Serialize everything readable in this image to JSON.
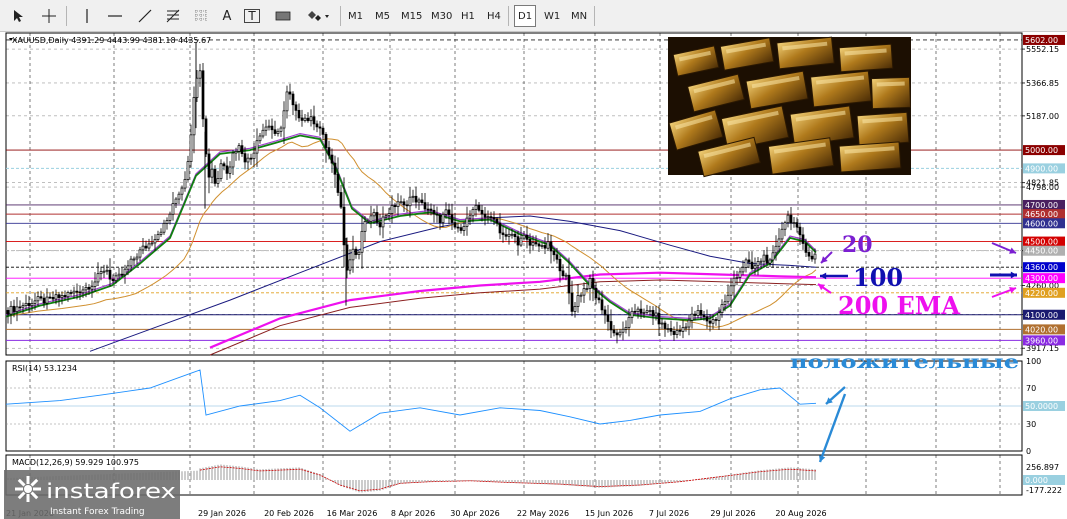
{
  "toolbar": {
    "icons": [
      "cursor-icon",
      "crosshair-icon",
      "vertical-line-icon",
      "horizontal-line-icon",
      "trendline-icon",
      "fibonacci-icon",
      "grid-channel-icon",
      "text-tool-icon",
      "text-label-icon",
      "rectangle-icon",
      "shapes-dropdown-icon"
    ],
    "text_tool_glyph": "A",
    "label_tool_glyph": "T",
    "timeframes": [
      "M1",
      "M5",
      "M15",
      "M30",
      "H1",
      "H4",
      "D1",
      "W1",
      "MN"
    ],
    "active_timeframe": "D1"
  },
  "chart_header": "XAUUSD,Daily  4391.29 4443.99 4381.18 4435.67",
  "price_axis": {
    "ticks": [
      {
        "label": "5552.15",
        "price": 5552.15
      },
      {
        "label": "5366.85",
        "price": 5366.85
      },
      {
        "label": "5187.00",
        "price": 5187.0
      },
      {
        "label": "4821.85",
        "price": 4821.85
      },
      {
        "label": "4798.00",
        "price": 4798.0
      },
      {
        "label": "4450.00",
        "price": 4450.0
      },
      {
        "label": "4260.00",
        "price": 4260.0
      },
      {
        "label": "4102.00",
        "price": 4102.0
      },
      {
        "label": "3917.15",
        "price": 3917.15
      }
    ],
    "levels": [
      {
        "label": "5602.00",
        "price": 5602,
        "bg": "#8b0000",
        "fg": "#ffffff",
        "line": "#222222",
        "dash": "4,3"
      },
      {
        "label": "5000.00",
        "price": 5000,
        "bg": "#8b0000",
        "fg": "#ffffff",
        "line": "#8b0000",
        "dash": ""
      },
      {
        "label": "4900.00",
        "price": 4900,
        "bg": "#9ad0e0",
        "fg": "#ffffff",
        "line": "#9ad0e0",
        "dash": "3,2"
      },
      {
        "label": "4700.00",
        "price": 4700,
        "bg": "#4a2060",
        "fg": "#ffffff",
        "line": "#4a2060",
        "dash": ""
      },
      {
        "label": "4650.00",
        "price": 4650,
        "bg": "#b03030",
        "fg": "#ffffff",
        "line": "#b03030",
        "dash": ""
      },
      {
        "label": "4600.00",
        "price": 4600,
        "bg": "#303090",
        "fg": "#ffffff",
        "line": "#303090",
        "dash": ""
      },
      {
        "label": "4500.00",
        "price": 4500,
        "bg": "#d40000",
        "fg": "#ffffff",
        "line": "#d40000",
        "dash": ""
      },
      {
        "label": "4450.00",
        "price": 4450,
        "bg": "#b0b0b0",
        "fg": "#ffffff",
        "line": "#b0b0b0",
        "dash": "3,2"
      },
      {
        "label": "4360.00",
        "price": 4360,
        "bg": "#0000cc",
        "fg": "#ffffff",
        "line": "#000000",
        "dash": "3,2"
      },
      {
        "label": "4300.00",
        "price": 4300,
        "bg": "#ff00ff",
        "fg": "#ffffff",
        "line": "#ff00ff",
        "dash": ""
      },
      {
        "label": "4220.00",
        "price": 4220,
        "bg": "#e0a020",
        "fg": "#ffffff",
        "line": "#e0a020",
        "dash": "3,2"
      },
      {
        "label": "4100.00",
        "price": 4100,
        "bg": "#1a1a70",
        "fg": "#ffffff",
        "line": "#1a1a70",
        "dash": ""
      },
      {
        "label": "4020.00",
        "price": 4020,
        "bg": "#b07030",
        "fg": "#ffffff",
        "line": "#b07030",
        "dash": ""
      },
      {
        "label": "3960.00",
        "price": 3960,
        "bg": "#8a2be2",
        "fg": "#ffffff",
        "line": "#8a2be2",
        "dash": ""
      }
    ]
  },
  "time_axis": [
    "29 Jan 2026",
    "20 Feb 2026",
    "16 Mar 2026",
    "8 Apr 2026",
    "30 Apr 2026",
    "22 May 2026",
    "15 Jun 2026",
    "7 Jul 2026",
    "29 Jul 2026",
    "20 Aug 2026"
  ],
  "rsi": {
    "label": "RSI(14) 53.1234",
    "ticks": [
      "100",
      "70",
      "30",
      "0"
    ],
    "current": "50.0000",
    "levels": [
      70,
      30
    ]
  },
  "macd": {
    "label": "MACD(12,26,9) 59.929 100.975",
    "ticks": [
      "256.897",
      "0.000",
      "-177.222"
    ]
  },
  "annotations": {
    "ma20": "20",
    "ma100": "100",
    "ema200": "200 EMA",
    "positive": "положительные",
    "colors": {
      "ma20": "#7b1fd1",
      "ma100": "#1010b0",
      "ema200": "#ee10ee",
      "positive": "#2a8ad6"
    }
  },
  "watermark": {
    "brand": "instaforex",
    "tagline": "Instant Forex Trading"
  },
  "chart_data": {
    "type": "candlestick",
    "symbol": "XAUUSD",
    "timeframe": "Daily",
    "x_dates": [
      "29 Jan 2026",
      "20 Feb 2026",
      "16 Mar 2026",
      "8 Apr 2026",
      "30 Apr 2026",
      "22 May 2026",
      "15 Jun 2026",
      "7 Jul 2026",
      "29 Jul 2026",
      "20 Aug 2026"
    ],
    "last_bar": {
      "open": 4391.29,
      "high": 4443.99,
      "low": 4381.18,
      "close": 4435.67
    },
    "ylim": [
      3880,
      5640
    ],
    "close_path": [
      [
        6,
        4120
      ],
      [
        14,
        4135
      ],
      [
        22,
        4150
      ],
      [
        30,
        4165
      ],
      [
        38,
        4180
      ],
      [
        46,
        4175
      ],
      [
        54,
        4190
      ],
      [
        62,
        4200
      ],
      [
        70,
        4215
      ],
      [
        78,
        4230
      ],
      [
        86,
        4250
      ],
      [
        94,
        4275
      ],
      [
        100,
        4320
      ],
      [
        106,
        4360
      ],
      [
        112,
        4280
      ],
      [
        118,
        4300
      ],
      [
        124,
        4330
      ],
      [
        130,
        4380
      ],
      [
        136,
        4420
      ],
      [
        142,
        4460
      ],
      [
        148,
        4480
      ],
      [
        154,
        4520
      ],
      [
        160,
        4560
      ],
      [
        166,
        4600
      ],
      [
        172,
        4680
      ],
      [
        178,
        4760
      ],
      [
        184,
        4820
      ],
      [
        188,
        4950
      ],
      [
        192,
        5150
      ],
      [
        196,
        5400
      ],
      [
        200,
        5450
      ],
      [
        204,
        5100
      ],
      [
        208,
        4850
      ],
      [
        212,
        4900
      ],
      [
        216,
        4800
      ],
      [
        222,
        4950
      ],
      [
        228,
        4880
      ],
      [
        234,
        5000
      ],
      [
        240,
        5020
      ],
      [
        246,
        4940
      ],
      [
        252,
        4960
      ],
      [
        258,
        5080
      ],
      [
        264,
        5120
      ],
      [
        270,
        5140
      ],
      [
        276,
        5060
      ],
      [
        282,
        5150
      ],
      [
        288,
        5340
      ],
      [
        292,
        5250
      ],
      [
        296,
        5200
      ],
      [
        302,
        5180
      ],
      [
        308,
        5170
      ],
      [
        314,
        5160
      ],
      [
        320,
        5120
      ],
      [
        326,
        5020
      ],
      [
        332,
        4920
      ],
      [
        338,
        4780
      ],
      [
        342,
        4650
      ],
      [
        346,
        4350
      ],
      [
        350,
        4400
      ],
      [
        354,
        4480
      ],
      [
        358,
        4380
      ],
      [
        362,
        4560
      ],
      [
        368,
        4620
      ],
      [
        374,
        4640
      ],
      [
        380,
        4600
      ],
      [
        386,
        4650
      ],
      [
        392,
        4680
      ],
      [
        398,
        4720
      ],
      [
        404,
        4690
      ],
      [
        410,
        4740
      ],
      [
        416,
        4730
      ],
      [
        422,
        4700
      ],
      [
        428,
        4680
      ],
      [
        434,
        4640
      ],
      [
        440,
        4620
      ],
      [
        446,
        4660
      ],
      [
        452,
        4600
      ],
      [
        458,
        4560
      ],
      [
        464,
        4600
      ],
      [
        470,
        4640
      ],
      [
        476,
        4680
      ],
      [
        482,
        4660
      ],
      [
        488,
        4620
      ],
      [
        494,
        4640
      ],
      [
        500,
        4560
      ],
      [
        506,
        4520
      ],
      [
        512,
        4540
      ],
      [
        518,
        4500
      ],
      [
        524,
        4520
      ],
      [
        530,
        4480
      ],
      [
        536,
        4500
      ],
      [
        542,
        4460
      ],
      [
        548,
        4480
      ],
      [
        554,
        4420
      ],
      [
        560,
        4360
      ],
      [
        566,
        4300
      ],
      [
        572,
        4120
      ],
      [
        578,
        4200
      ],
      [
        584,
        4240
      ],
      [
        590,
        4280
      ],
      [
        596,
        4200
      ],
      [
        602,
        4140
      ],
      [
        608,
        4060
      ],
      [
        614,
        4000
      ],
      [
        620,
        3990
      ],
      [
        626,
        4040
      ],
      [
        632,
        4100
      ],
      [
        638,
        4140
      ],
      [
        644,
        4100
      ],
      [
        650,
        4120
      ],
      [
        656,
        4090
      ],
      [
        662,
        4040
      ],
      [
        668,
        4020
      ],
      [
        674,
        4000
      ],
      [
        680,
        4010
      ],
      [
        686,
        4050
      ],
      [
        692,
        4090
      ],
      [
        698,
        4110
      ],
      [
        704,
        4080
      ],
      [
        710,
        4060
      ],
      [
        716,
        4080
      ],
      [
        722,
        4150
      ],
      [
        728,
        4200
      ],
      [
        734,
        4300
      ],
      [
        740,
        4340
      ],
      [
        746,
        4390
      ],
      [
        752,
        4350
      ],
      [
        758,
        4380
      ],
      [
        764,
        4420
      ],
      [
        770,
        4380
      ],
      [
        776,
        4460
      ],
      [
        782,
        4580
      ],
      [
        788,
        4640
      ],
      [
        794,
        4600
      ],
      [
        800,
        4520
      ],
      [
        806,
        4460
      ],
      [
        812,
        4400
      ],
      [
        816,
        4435
      ]
    ],
    "ma20_path": [
      [
        6,
        4090
      ],
      [
        40,
        4150
      ],
      [
        80,
        4200
      ],
      [
        112,
        4260
      ],
      [
        140,
        4380
      ],
      [
        170,
        4520
      ],
      [
        196,
        4860
      ],
      [
        220,
        4980
      ],
      [
        250,
        5000
      ],
      [
        276,
        5040
      ],
      [
        300,
        5080
      ],
      [
        320,
        5060
      ],
      [
        336,
        4900
      ],
      [
        352,
        4680
      ],
      [
        370,
        4600
      ],
      [
        400,
        4640
      ],
      [
        430,
        4660
      ],
      [
        460,
        4610
      ],
      [
        490,
        4620
      ],
      [
        520,
        4540
      ],
      [
        550,
        4480
      ],
      [
        570,
        4380
      ],
      [
        590,
        4260
      ],
      [
        610,
        4170
      ],
      [
        630,
        4100
      ],
      [
        660,
        4080
      ],
      [
        690,
        4070
      ],
      [
        710,
        4080
      ],
      [
        730,
        4150
      ],
      [
        750,
        4320
      ],
      [
        770,
        4380
      ],
      [
        790,
        4520
      ],
      [
        805,
        4500
      ],
      [
        816,
        4440
      ]
    ],
    "ma100_path": [
      [
        90,
        3900
      ],
      [
        160,
        4040
      ],
      [
        230,
        4180
      ],
      [
        300,
        4330
      ],
      [
        380,
        4500
      ],
      [
        440,
        4580
      ],
      [
        490,
        4630
      ],
      [
        530,
        4640
      ],
      [
        570,
        4610
      ],
      [
        620,
        4560
      ],
      [
        670,
        4480
      ],
      [
        710,
        4420
      ],
      [
        750,
        4380
      ],
      [
        790,
        4370
      ],
      [
        816,
        4360
      ]
    ],
    "ema200_path": [
      [
        210,
        3920
      ],
      [
        280,
        4080
      ],
      [
        350,
        4180
      ],
      [
        420,
        4230
      ],
      [
        480,
        4260
      ],
      [
        540,
        4280
      ],
      [
        600,
        4320
      ],
      [
        660,
        4330
      ],
      [
        720,
        4320
      ],
      [
        780,
        4310
      ],
      [
        816,
        4305
      ]
    ],
    "rsi_path": [
      [
        6,
        52
      ],
      [
        60,
        56
      ],
      [
        100,
        62
      ],
      [
        150,
        70
      ],
      [
        190,
        86
      ],
      [
        200,
        90
      ],
      [
        206,
        40
      ],
      [
        240,
        50
      ],
      [
        280,
        56
      ],
      [
        300,
        62
      ],
      [
        320,
        48
      ],
      [
        350,
        22
      ],
      [
        380,
        42
      ],
      [
        420,
        48
      ],
      [
        460,
        40
      ],
      [
        500,
        48
      ],
      [
        540,
        45
      ],
      [
        570,
        38
      ],
      [
        600,
        30
      ],
      [
        630,
        34
      ],
      [
        660,
        40
      ],
      [
        700,
        44
      ],
      [
        730,
        58
      ],
      [
        760,
        68
      ],
      [
        780,
        70
      ],
      [
        800,
        52
      ],
      [
        816,
        53
      ]
    ],
    "macd_hist": [
      [
        200,
        120
      ],
      [
        220,
        160
      ],
      [
        240,
        140
      ],
      [
        260,
        110
      ],
      [
        280,
        120
      ],
      [
        300,
        130
      ],
      [
        320,
        60
      ],
      [
        340,
        -60
      ],
      [
        360,
        -130
      ],
      [
        380,
        -110
      ],
      [
        400,
        -40
      ],
      [
        430,
        -20
      ],
      [
        470,
        -10
      ],
      [
        510,
        -30
      ],
      [
        560,
        -50
      ],
      [
        600,
        -80
      ],
      [
        640,
        -60
      ],
      [
        680,
        -20
      ],
      [
        720,
        40
      ],
      [
        760,
        100
      ],
      [
        790,
        130
      ],
      [
        816,
        110
      ]
    ]
  }
}
